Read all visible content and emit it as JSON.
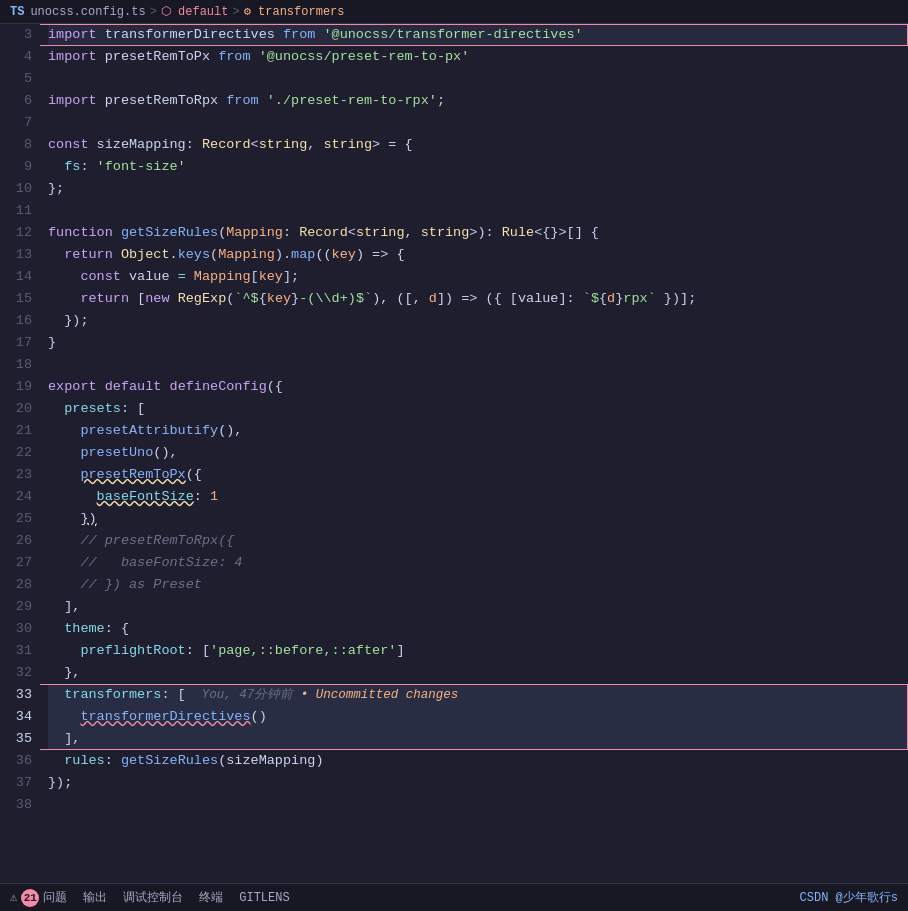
{
  "breadcrumb": {
    "ts_badge": "TS",
    "file": "unocss.config.ts",
    "sep1": ">",
    "symbol1": "⬡ default",
    "sep2": ">",
    "symbol2": "⚙ transformers"
  },
  "status_bar": {
    "problems_label": "问题",
    "problems_count": "21",
    "output_label": "输出",
    "debug_label": "调试控制台",
    "terminal_label": "终端",
    "gitlens_label": "GITLENS",
    "watermark": "CSDN @少年歌行s"
  },
  "lines": [
    {
      "num": 3,
      "content": "import transformerDirectives from '@unocss/transformer-directives'"
    },
    {
      "num": 4,
      "content": "import presetRemToPx from '@unocss/preset-rem-to-px'"
    },
    {
      "num": 5,
      "content": ""
    },
    {
      "num": 6,
      "content": "import presetRemToRpx from './preset-rem-to-rpx';"
    },
    {
      "num": 7,
      "content": ""
    },
    {
      "num": 8,
      "content": "const sizeMapping: Record<string, string> = {"
    },
    {
      "num": 9,
      "content": "  fs: 'font-size'"
    },
    {
      "num": 10,
      "content": "};"
    },
    {
      "num": 11,
      "content": ""
    },
    {
      "num": 12,
      "content": "function getSizeRules(Mapping: Record<string, string>): Rule<{}>[] {"
    },
    {
      "num": 13,
      "content": "  return Object.keys(Mapping).map((key) => {"
    },
    {
      "num": 14,
      "content": "    const value = Mapping[key];"
    },
    {
      "num": 15,
      "content": "    return [new RegExp(`^${key}-(\\\\d+)$`), ([, d]) => ({ [value]: `${d}rpx` })];"
    },
    {
      "num": 16,
      "content": "  });"
    },
    {
      "num": 17,
      "content": "}"
    },
    {
      "num": 18,
      "content": ""
    },
    {
      "num": 19,
      "content": "export default defineConfig({"
    },
    {
      "num": 20,
      "content": "  presets: ["
    },
    {
      "num": 21,
      "content": "    presetAttributify(),"
    },
    {
      "num": 22,
      "content": "    presetUno(),"
    },
    {
      "num": 23,
      "content": "    presetRemToPx({"
    },
    {
      "num": 24,
      "content": "      baseFontSize: 1"
    },
    {
      "num": 25,
      "content": "    })"
    },
    {
      "num": 26,
      "content": "    // presetRemToRpx({"
    },
    {
      "num": 27,
      "content": "    //   baseFontSize: 4"
    },
    {
      "num": 28,
      "content": "    // }) as Preset"
    },
    {
      "num": 29,
      "content": "  ],"
    },
    {
      "num": 30,
      "content": "  theme: {"
    },
    {
      "num": 31,
      "content": "    preflightRoot: ['page,::before,::after']"
    },
    {
      "num": 32,
      "content": "  },"
    },
    {
      "num": 33,
      "content": "  transformers: [",
      "blame": "You, 47分钟前 • Uncommitted changes"
    },
    {
      "num": 34,
      "content": "    transformerDirectives()"
    },
    {
      "num": 35,
      "content": "  ],"
    },
    {
      "num": 36,
      "content": "  rules: getSizeRules(sizeMapping)"
    },
    {
      "num": 37,
      "content": "});"
    },
    {
      "num": 38,
      "content": ""
    }
  ]
}
